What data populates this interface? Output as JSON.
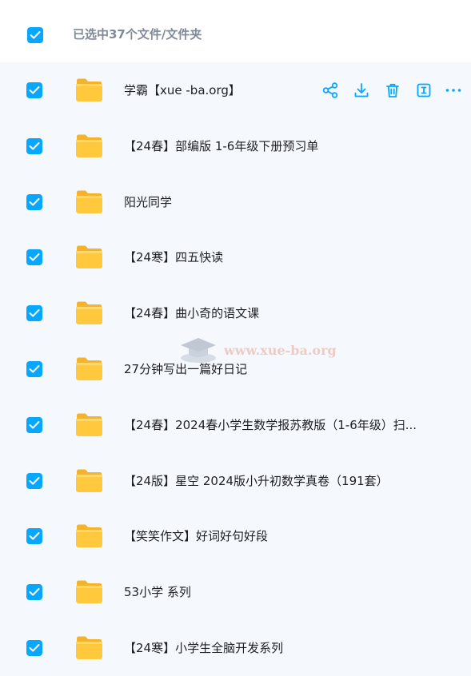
{
  "header": {
    "selection_text": "已选中37个文件/文件夹"
  },
  "rows": [
    {
      "name": "学霸【xue -ba.org】"
    },
    {
      "name": "【24春】部编版 1-6年级下册预习单"
    },
    {
      "name": "阳光同学"
    },
    {
      "name": "【24寒】四五快读"
    },
    {
      "name": "【24春】曲小奇的语文课"
    },
    {
      "name": "27分钟写出一篇好日记"
    },
    {
      "name": "【24春】2024春小学生数学报苏教版（1-6年级）扫..."
    },
    {
      "name": "【24版】星空 2024版小升初数学真卷（191套）"
    },
    {
      "name": "【笑笑作文】好词好句好段"
    },
    {
      "name": "53小学 系列"
    },
    {
      "name": "【24寒】小学生全脑开发系列"
    }
  ],
  "row_actions": [
    "share-icon",
    "download-icon",
    "delete-icon",
    "rename-icon",
    "more-icon"
  ],
  "watermark": {
    "text": "www.xue-ba.org"
  },
  "colors": {
    "accent": "#06a7ff",
    "folder": "#ffc83d",
    "header_text": "#818999",
    "background": "#f5f9fd"
  }
}
